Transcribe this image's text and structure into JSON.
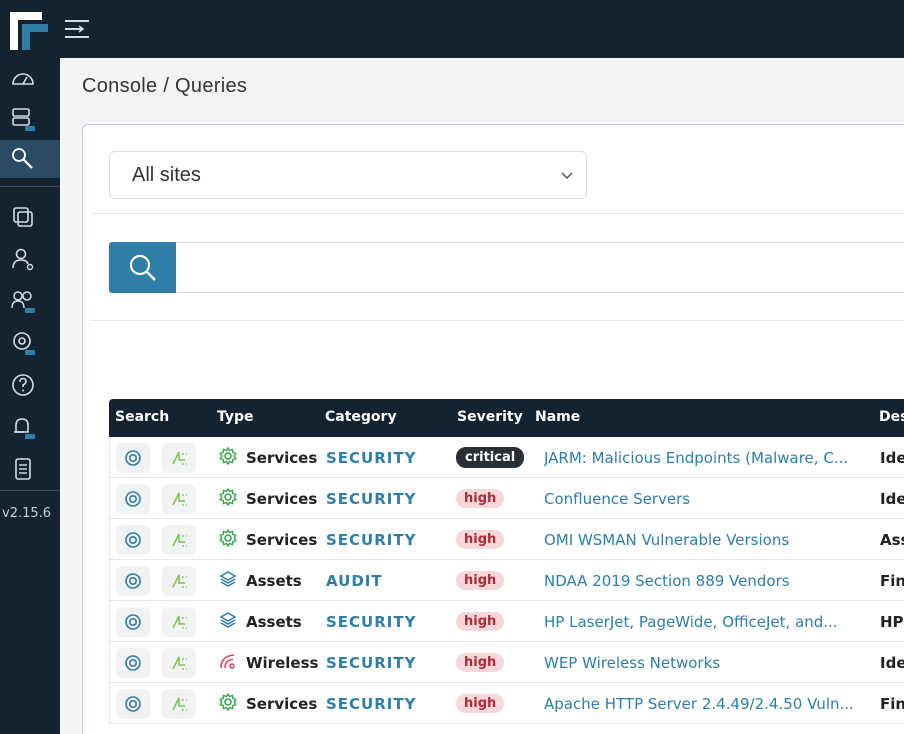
{
  "app": {
    "version": "v2.15.6",
    "accent_color": "#2e7ea8",
    "nav_color": "#15222f"
  },
  "sidebar": {
    "items": [
      {
        "name": "dashboard",
        "icon": "gauge-icon"
      },
      {
        "name": "servers",
        "icon": "server-icon"
      },
      {
        "name": "queries",
        "icon": "search-icon",
        "active": true
      },
      {
        "name": "assets",
        "icon": "layers-icon"
      },
      {
        "name": "user",
        "icon": "user-icon"
      },
      {
        "name": "users",
        "icon": "users-icon"
      },
      {
        "name": "location",
        "icon": "location-icon"
      },
      {
        "name": "help",
        "icon": "help-icon"
      },
      {
        "name": "alerts",
        "icon": "bell-icon"
      },
      {
        "name": "reports",
        "icon": "document-icon"
      }
    ]
  },
  "breadcrumb": "Console / Queries",
  "site_select": {
    "value": "All sites"
  },
  "search": {
    "placeholder": ""
  },
  "table": {
    "headers": {
      "search": "Search",
      "type": "Type",
      "category": "Category",
      "severity": "Severity",
      "name": "Name",
      "description": "Des"
    },
    "rows": [
      {
        "type": "Services",
        "type_icon": "gear-icon",
        "category": "SECURITY",
        "severity": "critical",
        "name": "JARM: Malicious Endpoints (Malware, C...",
        "description": "Ide"
      },
      {
        "type": "Services",
        "type_icon": "gear-icon",
        "category": "SECURITY",
        "severity": "high",
        "name": "Confluence Servers",
        "description": "Ide"
      },
      {
        "type": "Services",
        "type_icon": "gear-icon",
        "category": "SECURITY",
        "severity": "high",
        "name": "OMI WSMAN Vulnerable Versions",
        "description": "Ass"
      },
      {
        "type": "Assets",
        "type_icon": "layers-icon",
        "category": "AUDIT",
        "severity": "high",
        "name": "NDAA 2019 Section 889 Vendors",
        "description": "Fin"
      },
      {
        "type": "Assets",
        "type_icon": "layers-icon",
        "category": "SECURITY",
        "severity": "high",
        "name": "HP LaserJet, PageWide, OfficeJet, and...",
        "description": "HP"
      },
      {
        "type": "Wireless",
        "type_icon": "wifi-icon",
        "category": "SECURITY",
        "severity": "high",
        "name": "WEP Wireless Networks",
        "description": "Ide"
      },
      {
        "type": "Services",
        "type_icon": "gear-icon",
        "category": "SECURITY",
        "severity": "high",
        "name": "Apache HTTP Server 2.4.49/2.4.50 Vuln...",
        "description": "Fin"
      }
    ]
  }
}
